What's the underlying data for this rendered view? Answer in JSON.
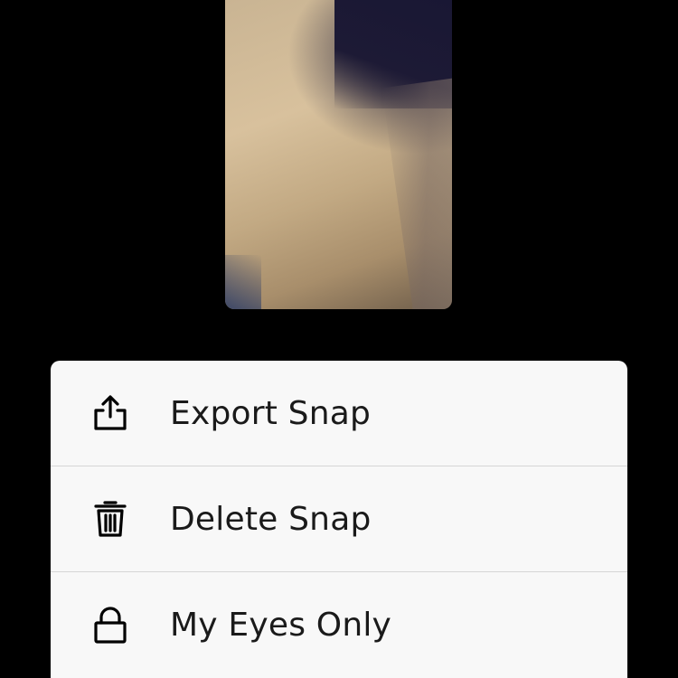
{
  "actions": [
    {
      "label": "Export Snap",
      "icon": "share-icon"
    },
    {
      "label": "Delete Snap",
      "icon": "trash-icon"
    },
    {
      "label": "My Eyes Only",
      "icon": "lock-icon"
    }
  ],
  "colors": {
    "background": "#000000",
    "sheet": "#f8f8f8",
    "text": "#1a1a1a",
    "divider": "#d6d6d6"
  }
}
